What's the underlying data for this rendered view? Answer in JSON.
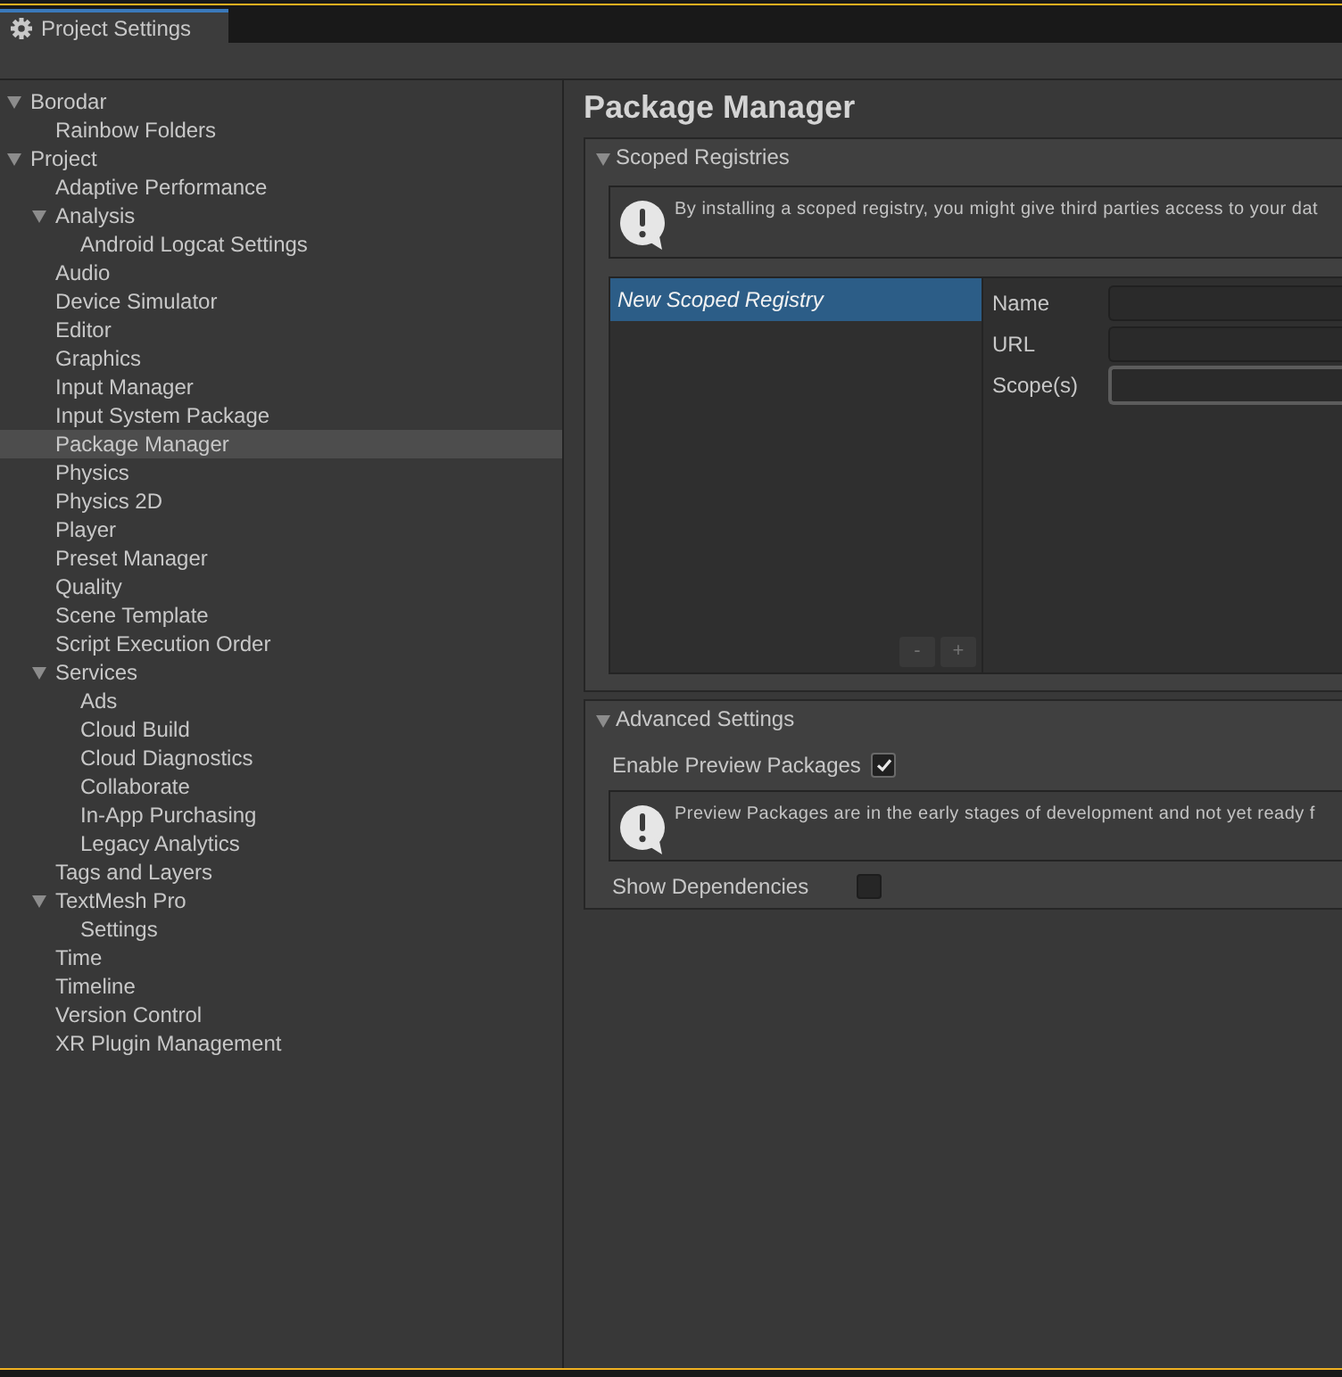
{
  "window": {
    "tabs": [
      {
        "label": "Project Settings",
        "selected": true
      }
    ]
  },
  "sidebar": {
    "items": [
      {
        "label": "Borodar",
        "selected": false,
        "expanded": true,
        "children": [
          {
            "label": "Rainbow Folders",
            "selected": false
          }
        ]
      },
      {
        "label": "Project",
        "selected": false,
        "expanded": true,
        "children": [
          {
            "label": "Adaptive Performance",
            "selected": false
          },
          {
            "label": "Analysis",
            "selected": false,
            "expanded": true,
            "children": [
              {
                "label": "Android Logcat Settings",
                "selected": false
              }
            ]
          },
          {
            "label": "Audio",
            "selected": false
          },
          {
            "label": "Device Simulator",
            "selected": false
          },
          {
            "label": "Editor",
            "selected": false
          },
          {
            "label": "Graphics",
            "selected": false
          },
          {
            "label": "Input Manager",
            "selected": false
          },
          {
            "label": "Input System Package",
            "selected": false
          },
          {
            "label": "Package Manager",
            "selected": true
          },
          {
            "label": "Physics",
            "selected": false
          },
          {
            "label": "Physics 2D",
            "selected": false
          },
          {
            "label": "Player",
            "selected": false
          },
          {
            "label": "Preset Manager",
            "selected": false
          },
          {
            "label": "Quality",
            "selected": false
          },
          {
            "label": "Scene Template",
            "selected": false
          },
          {
            "label": "Script Execution Order",
            "selected": false
          },
          {
            "label": "Services",
            "selected": false,
            "expanded": true,
            "children": [
              {
                "label": "Ads",
                "selected": false
              },
              {
                "label": "Cloud Build",
                "selected": false
              },
              {
                "label": "Cloud Diagnostics",
                "selected": false
              },
              {
                "label": "Collaborate",
                "selected": false
              },
              {
                "label": "In-App Purchasing",
                "selected": false
              },
              {
                "label": "Legacy Analytics",
                "selected": false
              }
            ]
          },
          {
            "label": "Tags and Layers",
            "selected": false
          },
          {
            "label": "TextMesh Pro",
            "selected": false,
            "expanded": true,
            "children": [
              {
                "label": "Settings",
                "selected": false
              }
            ]
          },
          {
            "label": "Time",
            "selected": false
          },
          {
            "label": "Timeline",
            "selected": false
          },
          {
            "label": "Version Control",
            "selected": false
          },
          {
            "label": "XR Plugin Management",
            "selected": false
          }
        ]
      }
    ]
  },
  "page": {
    "title": "Package Manager",
    "sections": [
      {
        "kind": "registry_editor",
        "title": "Scoped Registries",
        "expanded": true,
        "notice": "By installing a scoped registry, you might give third parties access to your dat",
        "registries": [
          {
            "label": "New Scoped Registry",
            "selected": true
          }
        ],
        "list_buttons": [
          "-",
          "+"
        ],
        "fields": [
          {
            "label": "Name",
            "focused": false
          },
          {
            "label": "URL",
            "focused": false
          },
          {
            "label": "Scope(s)",
            "focused": true
          }
        ]
      },
      {
        "kind": "options",
        "title": "Advanced Settings",
        "expanded": true,
        "rows": [
          {
            "kind": "checkbox",
            "label": "Enable Preview Packages",
            "checked": true
          },
          {
            "kind": "notice",
            "text": "Preview Packages are in the early stages of development and not yet ready f"
          },
          {
            "kind": "checkbox",
            "label": "Show Dependencies",
            "checked": false
          }
        ]
      }
    ]
  }
}
